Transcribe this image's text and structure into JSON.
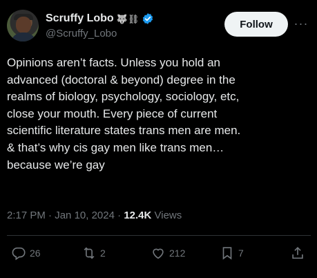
{
  "author": {
    "display_name": "Scruffy Lobo",
    "name_emojis": "🐺⛓",
    "handle": "@Scruffy_Lobo",
    "verified": true
  },
  "follow_label": "Follow",
  "tweet": {
    "lines": [
      "Opinions aren’t facts. Unless you hold an",
      "advanced (doctoral & beyond) degree in the",
      "realms of biology, psychology, sociology, etc,",
      "close your mouth. Every piece of current",
      "scientific literature states trans men are men.",
      "& that’s why cis gay men like trans men…",
      "because we’re gay"
    ]
  },
  "meta": {
    "time": "2:17 PM",
    "date": "Jan 10, 2024",
    "views_count": "12.4K",
    "views_label": "Views"
  },
  "actions": {
    "replies": "26",
    "reposts": "2",
    "likes": "212",
    "bookmarks": "7"
  },
  "colors": {
    "background": "#000000",
    "text": "#e7e9ea",
    "secondary": "#71767b",
    "verified": "#1d9bf0"
  }
}
